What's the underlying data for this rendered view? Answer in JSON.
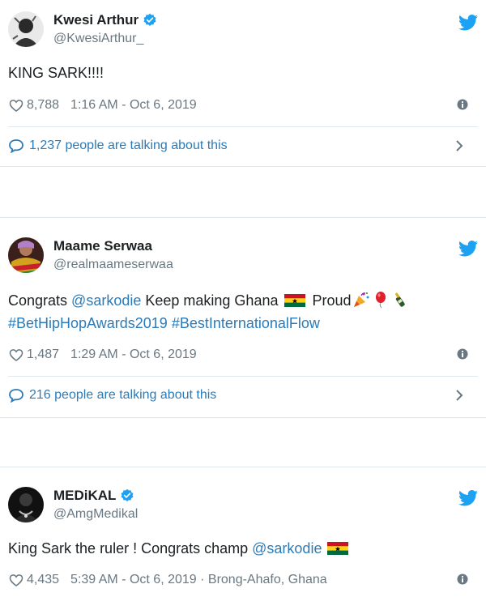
{
  "tweets": [
    {
      "name": "Kwesi Arthur",
      "verified": true,
      "handle": "@KwesiArthur_",
      "text": "KING SARK!!!!",
      "likes": "8,788",
      "timestamp": "1:16 AM - Oct 6, 2019",
      "talking": "1,237 people are talking about this"
    },
    {
      "name": "Maame Serwaa",
      "verified": false,
      "handle": "@realmaameserwaa",
      "text_part1": "Congrats ",
      "mention": "@sarkodie",
      "text_part2": " Keep making Ghana ",
      "text_part3": " Proud",
      "hashtag1": "#BetHipHopAwards2019",
      "hashtag2": "#BestInternationalFlow",
      "likes": "1,487",
      "timestamp": "1:29 AM - Oct 6, 2019",
      "talking": "216 people are talking about this"
    },
    {
      "name": "MEDiKAL",
      "verified": true,
      "handle": "@AmgMedikal",
      "text_part1": "King Sark the ruler ! Congrats champ ",
      "mention": "@sarkodie",
      "likes": "4,435",
      "timestamp": "5:39 AM - Oct 6, 2019 · Brong-Ahafo, Ghana"
    }
  ],
  "colors": {
    "link": "#2b7bb9",
    "twitter_blue": "#1da1f2",
    "muted": "#697882",
    "divider": "#e1e8ed"
  },
  "icons": [
    "twitter-bird-icon",
    "verified-badge-icon",
    "heart-icon",
    "info-icon",
    "speech-bubble-icon",
    "chevron-right-icon",
    "ghana-flag-icon",
    "party-popper-icon",
    "balloon-icon",
    "champagne-icon"
  ]
}
